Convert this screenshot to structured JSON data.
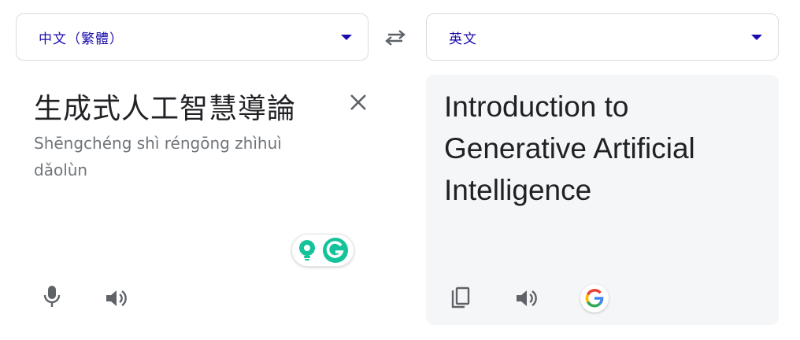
{
  "source_language": {
    "label": "中文（繁體）"
  },
  "target_language": {
    "label": "英文"
  },
  "source": {
    "text": "生成式人工智慧導論",
    "romanization": "Shēngchéng shì réngōng zhìhuì dǎolùn"
  },
  "target": {
    "text": "Introduction to Generative Artificial Intelligence"
  },
  "icons": {
    "swap": "swap-languages-icon",
    "clear": "close-icon",
    "mic": "microphone-icon",
    "speaker": "speaker-icon",
    "copy": "copy-icon",
    "google": "google-g-icon",
    "grammarly": "grammarly-icon"
  },
  "colors": {
    "accent": "#1a0dab",
    "target_bg": "#f5f6f8",
    "grammarly_green": "#15c39a"
  }
}
